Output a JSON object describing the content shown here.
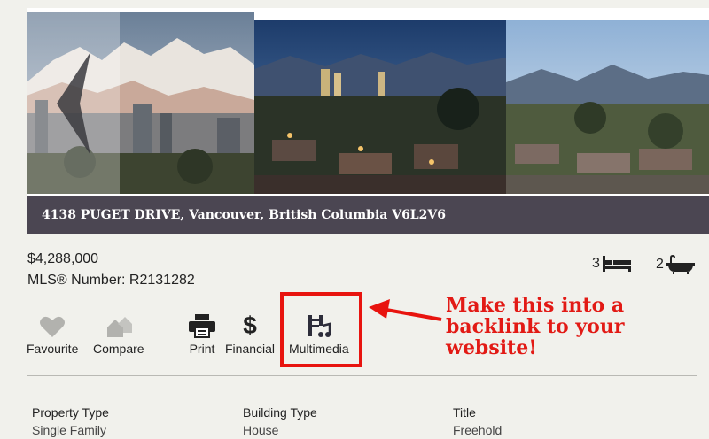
{
  "listing": {
    "address": "4138 PUGET DRIVE, Vancouver, British Columbia   V6L2V6",
    "price": "$4,288,000",
    "mls": "MLS® Number: R2131282",
    "beds": "3",
    "baths": "2"
  },
  "actions": [
    {
      "label": "Favourite",
      "icon": "heart-icon"
    },
    {
      "label": "Compare",
      "icon": "houses-icon"
    },
    {
      "label": "Print",
      "icon": "printer-icon"
    },
    {
      "label": "Financial",
      "icon": "dollar-icon"
    },
    {
      "label": "Multimedia",
      "icon": "multimedia-icon"
    }
  ],
  "annotation": {
    "text": "Make this into a backlink to your website!",
    "color": "#e8140f"
  },
  "details": [
    {
      "heading": "Property Type",
      "value": "Single Family"
    },
    {
      "heading": "Building Type",
      "value": "House"
    },
    {
      "heading": "Title",
      "value": "Freehold"
    }
  ]
}
